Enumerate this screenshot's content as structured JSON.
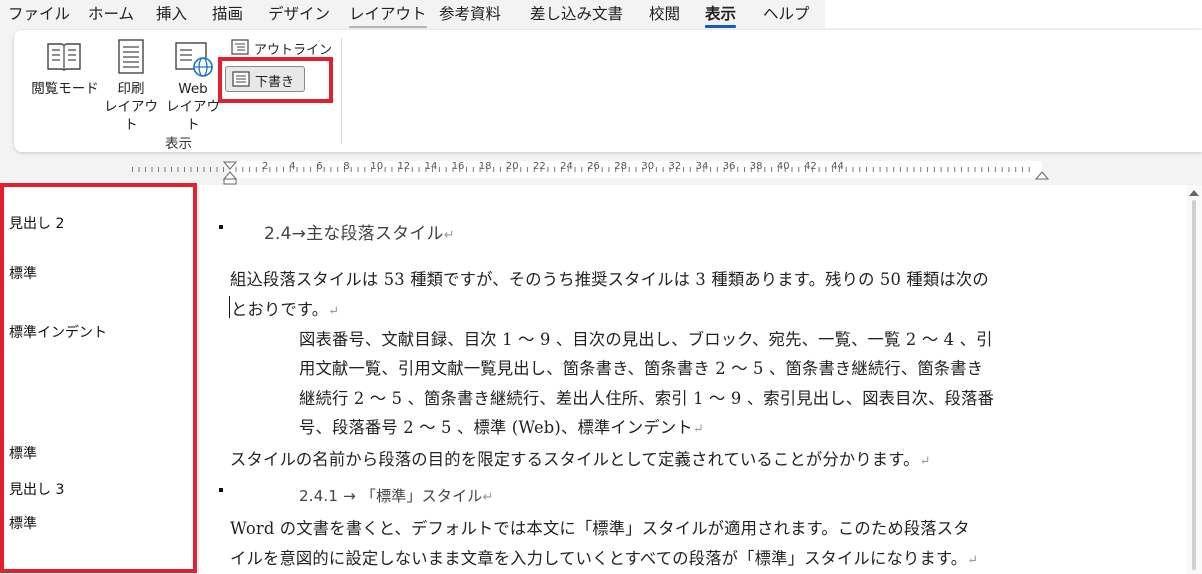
{
  "tabs": [
    {
      "label": "ファイル"
    },
    {
      "label": "ホーム"
    },
    {
      "label": "挿入"
    },
    {
      "label": "描画"
    },
    {
      "label": "デザイン"
    },
    {
      "label": "レイアウト"
    },
    {
      "label": "参考資料"
    },
    {
      "label": "差し込み文書"
    },
    {
      "label": "校閲"
    },
    {
      "label": "表示"
    },
    {
      "label": "ヘルプ"
    }
  ],
  "active_tab": "表示",
  "ribbon": {
    "reading_mode": "閲覧モード",
    "print_layout_1": "印刷",
    "print_layout_2": "レイアウト",
    "web_layout_1": "Web",
    "web_layout_2": "レイアウト",
    "outline": "アウトライン",
    "draft": "下書き",
    "group_label": "表示"
  },
  "ruler_numbers": [
    "2",
    "4",
    "6",
    "8",
    "10",
    "12",
    "14",
    "16",
    "18",
    "20",
    "22",
    "24",
    "26",
    "28",
    "30",
    "32",
    "34",
    "36",
    "38",
    "40",
    "42",
    "44"
  ],
  "style_pane": {
    "items": [
      "見出し 2",
      "標準",
      "標準インデント",
      "標準",
      "見出し 3",
      "標準"
    ]
  },
  "document": {
    "heading1": "2.4→主な段落スタイル",
    "p1_line1": "組込段落スタイルは 53 種類ですが、そのうち推奨スタイルは 3 種類あります。残りの 50 種類は次の",
    "p1_line2": "とおりです。",
    "indent_lines": [
      "図表番号、文献目録、目次 1 〜 9 、目次の見出し、ブロック、宛先、一覧、一覧 2 〜 4 、引",
      "用文献一覧、引用文献一覧見出し、箇条書き、箇条書き 2 〜 5 、箇条書き継続行、箇条書き",
      "継続行 2 〜 5 、箇条書き継続行、差出人住所、索引 1 〜 9 、索引見出し、図表目次、段落番",
      "号、段落番号 2 〜 5 、標準 (Web)、標準インデント"
    ],
    "p2": "スタイルの名前から段落の目的を限定するスタイルとして定義されていることが分かります。",
    "heading2": "2.4.1 → 「標準」スタイル",
    "p3_line1": "Word の文書を書くと、デフォルトでは本文に「標準」スタイルが適用されます。このため段落スタ",
    "p3_line2": "イルを意図的に設定しないまま文章を入力していくとすべての段落が「標準」スタイルになります。",
    "pilcrow": "↵"
  },
  "colors": {
    "highlight_box": "#e5202e",
    "active_tab_underline": "#185abd",
    "ribbon_bg": "#f3f3f3"
  }
}
